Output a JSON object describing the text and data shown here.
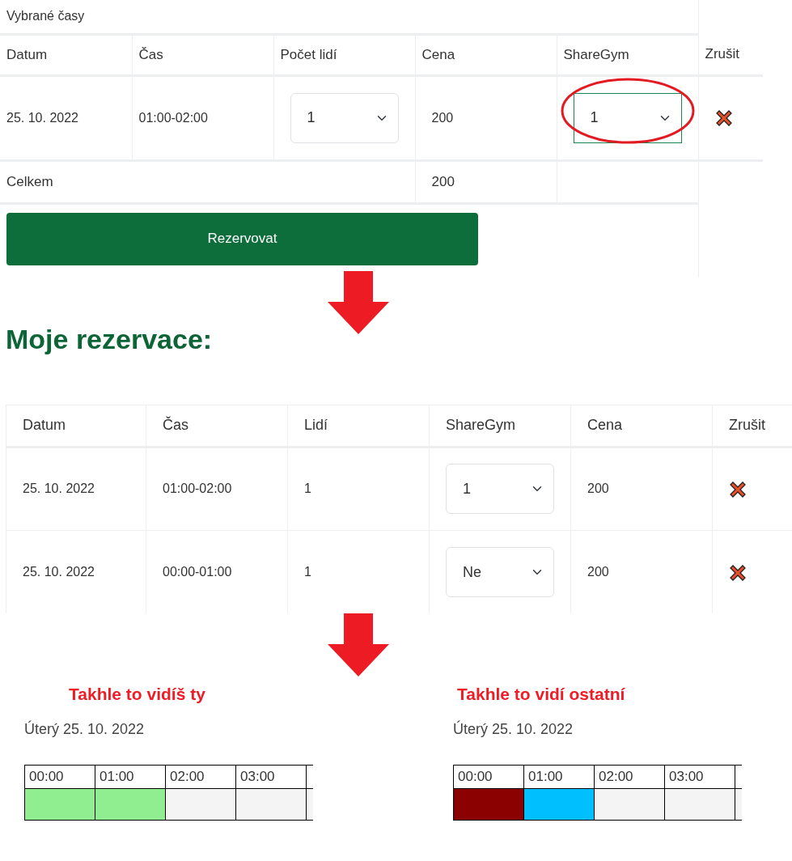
{
  "selected_times": {
    "caption": "Vybrané časy",
    "columns": [
      "Datum",
      "Čas",
      "Počet lidí",
      "Cena",
      "ShareGym",
      "Zrušit"
    ],
    "rows": [
      {
        "date": "25. 10. 2022",
        "time": "01:00-02:00",
        "people": "1",
        "price": "200",
        "sharegym": "1",
        "circled": true
      }
    ],
    "total": {
      "label": "Celkem",
      "price": "200"
    },
    "reserve_button": "Rezervovat"
  },
  "my_reservations": {
    "title": "Moje rezervace:",
    "columns": [
      "Datum",
      "Čas",
      "Lidí",
      "ShareGym",
      "Cena",
      "Zrušit"
    ],
    "rows": [
      {
        "date": "25. 10. 2022",
        "time": "01:00-02:00",
        "people": "1",
        "sharegym": "1",
        "price": "200"
      },
      {
        "date": "25. 10. 2022",
        "time": "00:00-01:00",
        "people": "1",
        "sharegym": "Ne",
        "price": "200"
      }
    ]
  },
  "views": [
    {
      "title": "Takhle to vidíš ty",
      "day": "Úterý 25. 10. 2022",
      "slots": [
        {
          "time": "00:00",
          "color": "#90ee90"
        },
        {
          "time": "01:00",
          "color": "#90ee90"
        },
        {
          "time": "02:00",
          "color": "#f4f4f4"
        },
        {
          "time": "03:00",
          "color": "#f4f4f4"
        },
        {
          "color": "#f4f4f4"
        }
      ]
    },
    {
      "title": "Takhle to vidí ostatní",
      "day": "Úterý 25. 10. 2022",
      "slots": [
        {
          "time": "00:00",
          "color": "#8b0000"
        },
        {
          "time": "01:00",
          "color": "#00bfff"
        },
        {
          "time": "02:00",
          "color": "#f4f4f4"
        },
        {
          "time": "03:00",
          "color": "#f4f4f4"
        },
        {
          "color": "#f4f4f4"
        }
      ]
    }
  ]
}
